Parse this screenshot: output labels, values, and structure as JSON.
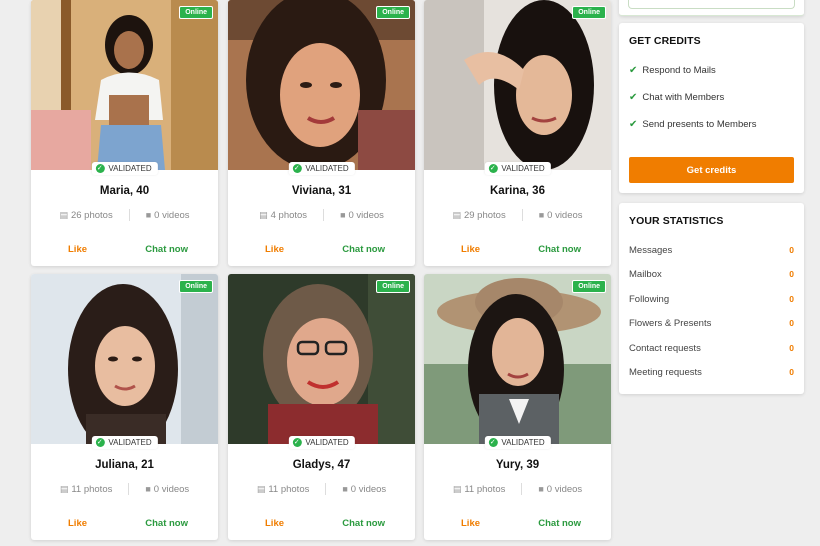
{
  "profiles": [
    {
      "name": "Maria, 40",
      "photos": "26 photos",
      "videos": "0 videos",
      "status": "Online",
      "badge": "VALIDATED",
      "like": "Like",
      "chat": "Chat now"
    },
    {
      "name": "Viviana, 31",
      "photos": "4 photos",
      "videos": "0 videos",
      "status": "Online",
      "badge": "VALIDATED",
      "like": "Like",
      "chat": "Chat now"
    },
    {
      "name": "Karina, 36",
      "photos": "29 photos",
      "videos": "0 videos",
      "status": "Online",
      "badge": "VALIDATED",
      "like": "Like",
      "chat": "Chat now"
    },
    {
      "name": "Juliana, 21",
      "photos": "11 photos",
      "videos": "0 videos",
      "status": "Online",
      "badge": "VALIDATED",
      "like": "Like",
      "chat": "Chat now"
    },
    {
      "name": "Gladys, 47",
      "photos": "11 photos",
      "videos": "0 videos",
      "status": "Online",
      "badge": "VALIDATED",
      "like": "Like",
      "chat": "Chat now"
    },
    {
      "name": "Yury, 39",
      "photos": "11 photos",
      "videos": "0 videos",
      "status": "Online",
      "badge": "VALIDATED",
      "like": "Like",
      "chat": "Chat now"
    }
  ],
  "credits": {
    "title": "GET CREDITS",
    "perks": [
      "Respond to Mails",
      "Chat with Members",
      "Send presents to Members"
    ],
    "button": "Get credits"
  },
  "stats": {
    "title": "YOUR STATISTICS",
    "items": [
      {
        "label": "Messages",
        "value": "0"
      },
      {
        "label": "Mailbox",
        "value": "0"
      },
      {
        "label": "Following",
        "value": "0"
      },
      {
        "label": "Flowers & Presents",
        "value": "0"
      },
      {
        "label": "Contact requests",
        "value": "0"
      },
      {
        "label": "Meeting requests",
        "value": "0"
      }
    ]
  },
  "colors": {
    "accent": "#f07d00",
    "online": "#2bb24c",
    "chat": "#2b9a3f"
  },
  "icons": {
    "photos": "photos-icon",
    "videos": "video-camera-icon",
    "validated": "check-circle-icon",
    "perk": "checkmark-icon"
  }
}
